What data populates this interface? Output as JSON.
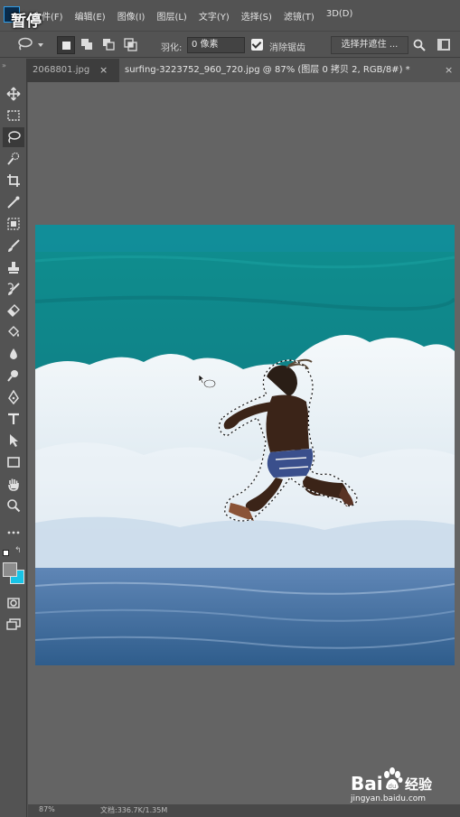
{
  "overlay": {
    "pause_label": "暂停"
  },
  "menu": {
    "items": [
      "文件(F)",
      "编辑(E)",
      "图像(I)",
      "图层(L)",
      "文字(Y)",
      "选择(S)",
      "滤镜(T)",
      "3D(D)"
    ]
  },
  "options": {
    "tool_icon": "lasso-icon",
    "feather_label": "羽化:",
    "feather_value": "0 像素",
    "anti_alias_checked": true,
    "anti_alias_label": "消除锯齿",
    "select_mask_label": "选择并遮住 ..."
  },
  "tabs": [
    {
      "label": "2068801.jpg",
      "active": false
    },
    {
      "label": "surfing-3223752_960_720.jpg @ 87% (图层 0 拷贝 2, RGB/8#) *",
      "active": true
    }
  ],
  "toolbar": {
    "active_tool": "lasso-icon",
    "foreground_color": "#8c8c8c",
    "background_color": "#17c3e6"
  },
  "status": {
    "zoom": "87%",
    "doc": "文档:336.7K/1.35M"
  },
  "watermark": {
    "brand_bai": "Bai",
    "brand_du": "经验",
    "url": "jingyan.baidu.com"
  }
}
